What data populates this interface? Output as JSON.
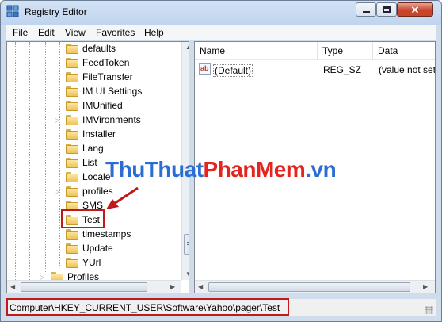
{
  "window": {
    "title": "Registry Editor"
  },
  "menu": [
    "File",
    "Edit",
    "View",
    "Favorites",
    "Help"
  ],
  "tree": {
    "items": [
      {
        "label": "defaults",
        "expandable": false
      },
      {
        "label": "FeedToken",
        "expandable": false
      },
      {
        "label": "FileTransfer",
        "expandable": false
      },
      {
        "label": "IM UI Settings",
        "expandable": false
      },
      {
        "label": "IMUnified",
        "expandable": false
      },
      {
        "label": "IMVironments",
        "expandable": true
      },
      {
        "label": "Installer",
        "expandable": false
      },
      {
        "label": "Lang",
        "expandable": false
      },
      {
        "label": "List",
        "expandable": false
      },
      {
        "label": "Locale",
        "expandable": false
      },
      {
        "label": "profiles",
        "expandable": true
      },
      {
        "label": "SMS",
        "expandable": false
      },
      {
        "label": "Test",
        "expandable": false,
        "highlighted": true
      },
      {
        "label": "timestamps",
        "expandable": false
      },
      {
        "label": "Update",
        "expandable": false
      },
      {
        "label": "YUrl",
        "expandable": false
      }
    ],
    "parent_item": {
      "label": "Profiles",
      "expandable": true
    }
  },
  "list": {
    "columns": [
      "Name",
      "Type",
      "Data"
    ],
    "rows": [
      {
        "name": "(Default)",
        "type": "REG_SZ",
        "data": "(value not set)"
      }
    ]
  },
  "status": {
    "path": "Computer\\HKEY_CURRENT_USER\\Software\\Yahoo\\pager\\Test"
  },
  "watermark": {
    "part1": "ThuThuat",
    "part2": "PhanMem",
    "part3": ".vn"
  },
  "colors": {
    "annotation_red": "#c0181b",
    "watermark_blue": "#2a6dd3",
    "watermark_red": "#e4251f"
  }
}
